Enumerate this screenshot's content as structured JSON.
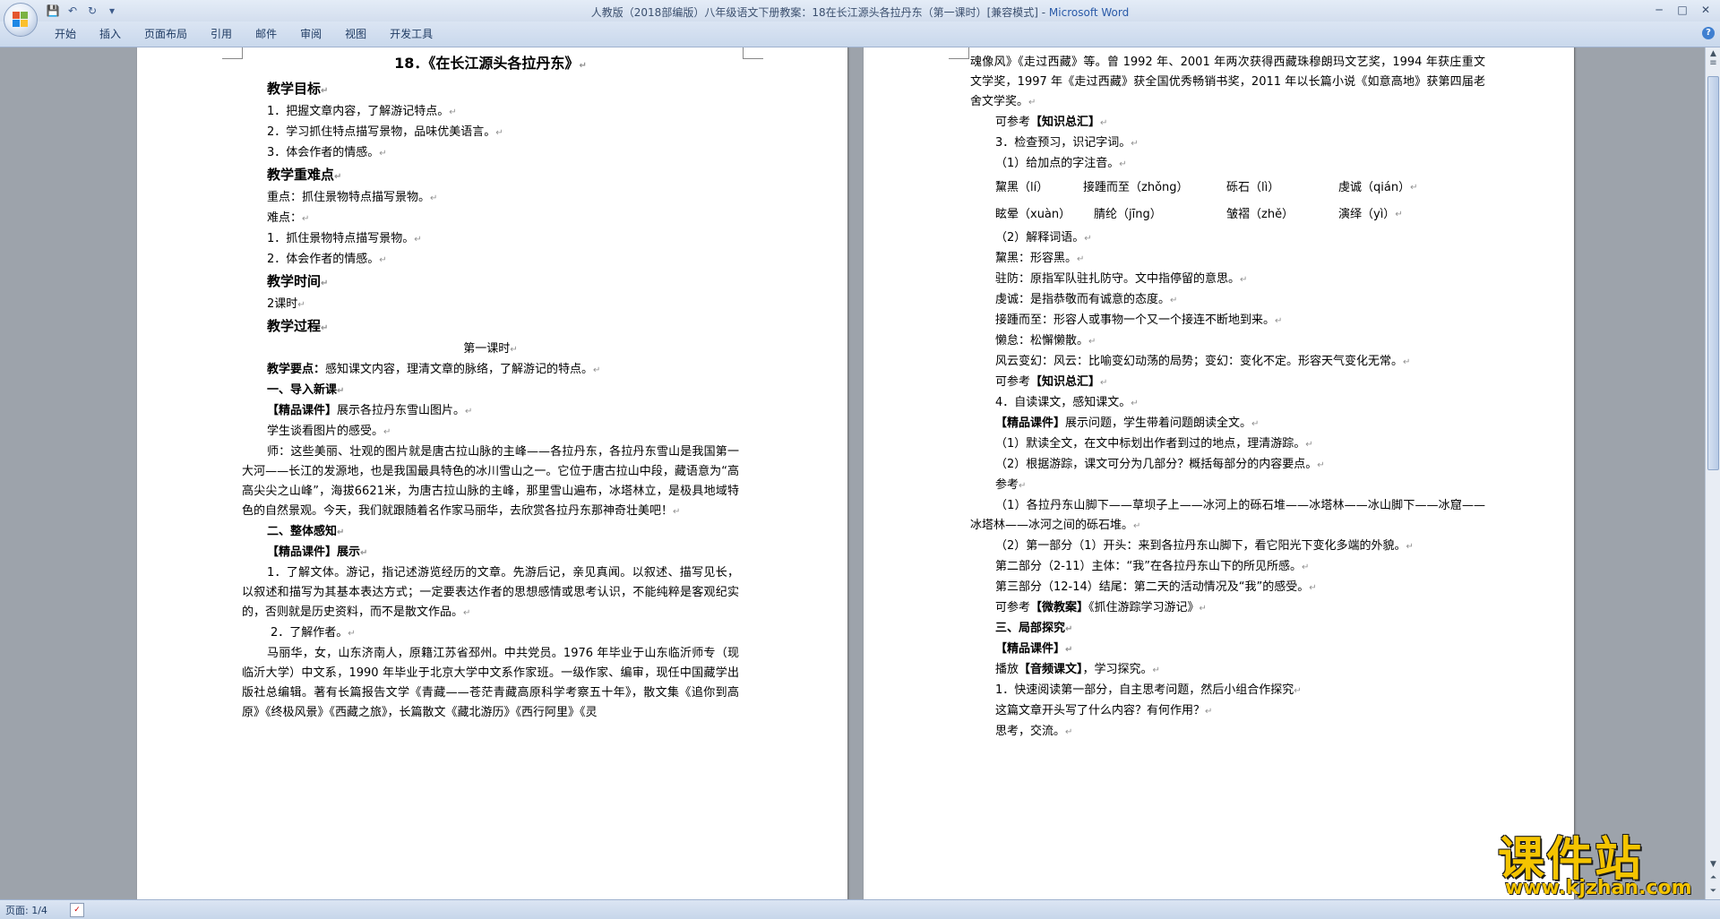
{
  "window": {
    "title": "人教版（2018部编版）八年级语文下册教案：18在长江源头各拉丹东（第一课时）[兼容模式] - ",
    "app_name": "Microsoft Word",
    "minimize": "─",
    "maximize": "□",
    "close": "✕"
  },
  "qat": {
    "save": "💾",
    "undo": "↶",
    "redo": "↻",
    "more": "▾"
  },
  "ribbon": {
    "tabs": [
      "开始",
      "插入",
      "页面布局",
      "引用",
      "邮件",
      "审阅",
      "视图",
      "开发工具"
    ],
    "help": "?"
  },
  "page1": {
    "title": "18．《在长江源头各拉丹东》",
    "lines": [
      "教学目标",
      "1．把握文章内容，了解游记特点。",
      "2．学习抓住特点描写景物，品味优美语言。",
      "3．体会作者的情感。",
      "教学重难点",
      "重点：抓住景物特点描写景物。",
      "难点：",
      "1．抓住景物特点描写景物。",
      "2．体会作者的情感。",
      "教学时间",
      "2课时",
      "教学过程",
      "第一课时",
      "教学要点：",
      "感知课文内容，理清文章的脉络，了解游记的特点。",
      "一、导入新课",
      "【精品课件】",
      "展示各拉丹东雪山图片。",
      "学生谈看图片的感受。",
      "师：这些美丽、壮观的图片就是唐古拉山脉的主峰——各拉丹东，各拉丹东雪山是我国第一大河——长江的发源地，也是我国最具特色的冰川雪山之一。它位于唐古拉山中段，藏语意为“高高尖尖之山峰”，海拔6621米，为唐古拉山脉的主峰，那里雪山遍布，冰塔林立，是极具地域特色的自然景观。今天，我们就跟随着名作家马丽华，去欣赏各拉丹东那神奇壮美吧！",
      "二、整体感知",
      "【精品课件】展示",
      "1．了解文体。游记，指记述游览经历的文章。先游后记，亲见真闻。以叙述、描写见长，以叙述和描写为其基本表达方式；一定要表达作者的思想感情或思考认识，不能纯粹是客观纪实的，否则就是历史资料，而不是散文作品。",
      "2．了解作者。",
      "马丽华，女，山东济南人，原籍江苏省邳州。中共党员。1976 年毕业于山东临沂师专（现临沂大学）中文系，1990 年毕业于北京大学中文系作家班。一级作家、编审，现任中国藏学出版社总编辑。著有长篇报告文学《青藏——苍茫青藏高原科学考察五十年》，散文集《追你到高原》《终极风景》《西藏之旅》，长篇散文《藏北游历》《西行阿里》《灵"
    ]
  },
  "page2": {
    "lines": [
      "魂像风》《走过西藏》等。曾 1992 年、2001 年两次获得西藏珠穆朗玛文艺奖，1994 年获庄重文文学奖，1997 年《走过西藏》获全国优秀畅销书奖，2011 年以长篇小说《如意高地》获第四届老舍文学奖。",
      "可参考",
      "【知识总汇】",
      "3．检查预习，识记字词。",
      "（1）给加点的字注音。",
      "（2）解释词语。",
      "黧黑：形容黑。",
      "驻防：原指军队驻扎防守。文中指停留的意思。",
      "虔诚：是指恭敬而有诚意的态度。",
      "接踵而至：形容人或事物一个又一个接连不断地到来。",
      "懒怠：松懈懒散。",
      "风云变幻：风云：比喻变幻动荡的局势；变幻：变化不定。形容天气变化无常。",
      "可参考",
      "【知识总汇】",
      "4．自读课文，感知课文。",
      "【精品课件】",
      "展示问题，学生带着问题朗读全文。",
      "（1）默读全文，在文中标划出作者到过的地点，理清游踪。",
      "（2）根据游踪，课文可分为几部分？概括每部分的内容要点。",
      "参考",
      "（1）各拉丹东山脚下——草坝子上——冰河上的砾石堆——冰塔林——冰山脚下——冰窟——冰塔林——冰河之间的砾石堆。",
      "（2）第一部分（1）开头：来到各拉丹东山脚下，看它阳光下变化多端的外貌。",
      "第二部分（2-11）主体：“我”在各拉丹东山下的所见所感。",
      "第三部分（12-14）结尾：第二天的活动情况及“我”的感受。",
      "可参考",
      "【微教案】",
      "《抓住游踪学习游记》",
      "三、局部探究",
      "【精品课件】",
      "播放",
      "【音频课文】",
      "，学习探究。",
      "1．快速阅读第一部分，自主思考问题，然后小组合作探究",
      "这篇文章开头写了什么内容？有何作用？",
      "思考，交流。"
    ],
    "pinyin": [
      [
        "黧黑（lí）",
        "接踵而至（zhǒng）",
        "砾石（lì）",
        "虔诚（qián）"
      ],
      [
        "眩晕（xuàn）",
        "腈纶（jīng）",
        "皱褶（zhě）",
        "演绎（yì）"
      ]
    ]
  },
  "status": {
    "page": "页面: 1/4",
    "proof": "✓"
  },
  "watermark": {
    "title": "课件站",
    "url": "www.kjzhan.com"
  },
  "para_mark": "↵"
}
